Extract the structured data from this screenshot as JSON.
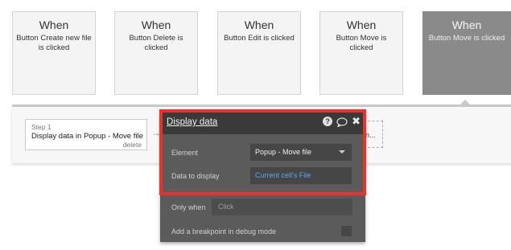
{
  "events": [
    {
      "when": "When",
      "desc": "Button Create new file is clicked"
    },
    {
      "when": "When",
      "desc": "Button Delete is clicked"
    },
    {
      "when": "When",
      "desc": "Button Edit is clicked"
    },
    {
      "when": "When",
      "desc": "Button Move is clicked"
    },
    {
      "when": "When",
      "desc": "Button Move is clicked"
    }
  ],
  "step": {
    "number": "Step 1",
    "title": "Display data in Popup - Move file",
    "delete_label": "delete"
  },
  "ghost_step_text": "n...",
  "panel": {
    "title": "Display data",
    "element_label": "Element",
    "element_value": "Popup - Move file",
    "data_label": "Data to display",
    "data_value": "Current cell's File",
    "only_when_label": "Only when",
    "only_when_placeholder": "Click",
    "breakpoint_label": "Add a breakpoint in debug mode"
  },
  "colors": {
    "highlight": "#e8322b",
    "expression": "#5aa6f2",
    "active_event": "#8a8a8a"
  }
}
